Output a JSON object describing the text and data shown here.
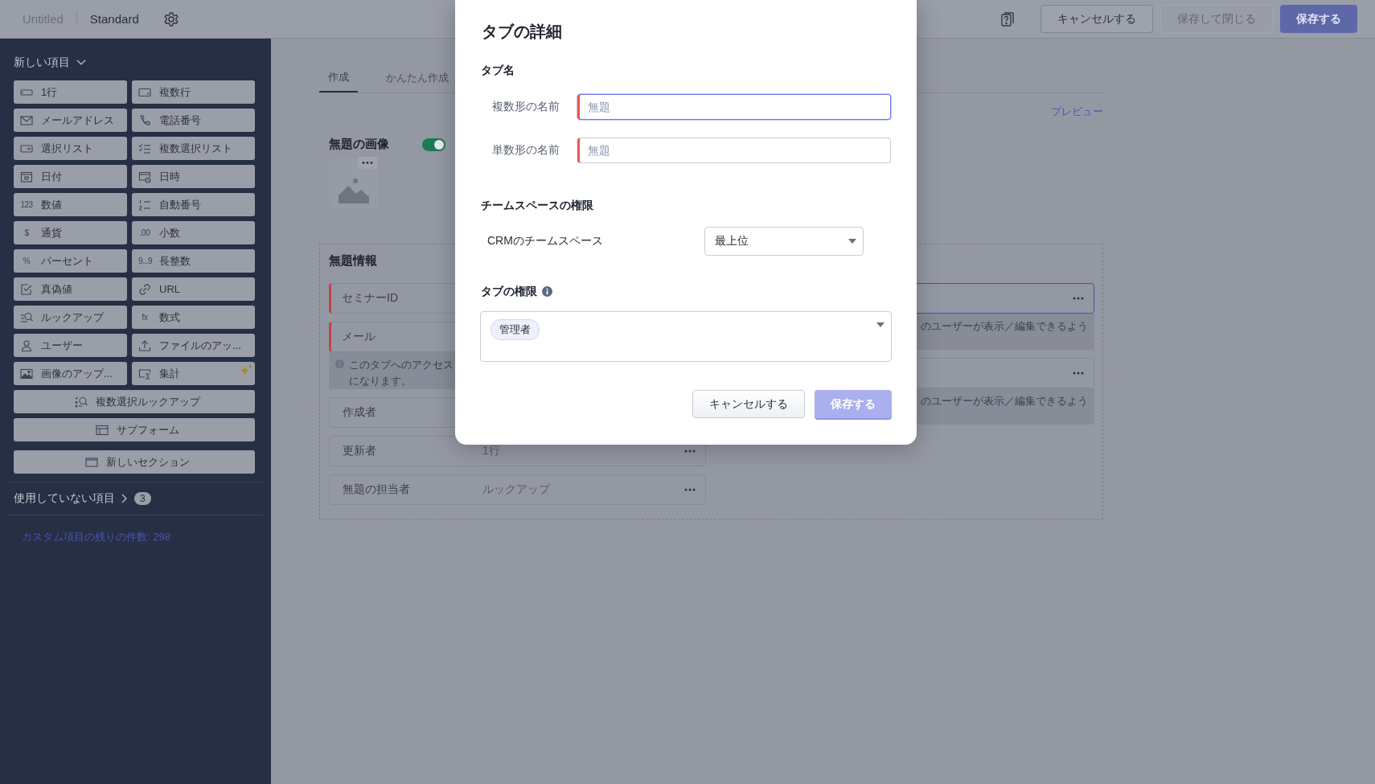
{
  "top_bar": {
    "title": "Untitled",
    "layout": "Standard",
    "buttons": [
      {
        "label": "キャンセルする",
        "kind": "secondary",
        "disabled": false
      },
      {
        "label": "保存して閉じる",
        "kind": "secondary",
        "disabled": true
      },
      {
        "label": "保存する",
        "kind": "primary",
        "disabled": false
      }
    ]
  },
  "sidebar": {
    "heading": "新しい項目",
    "field_types": [
      {
        "label": "1行"
      },
      {
        "label": "複数行"
      },
      {
        "label": "メールアドレス"
      },
      {
        "label": "電話番号"
      },
      {
        "label": "選択リスト"
      },
      {
        "label": "複数選択リスト"
      },
      {
        "label": "日付"
      },
      {
        "label": "日時"
      },
      {
        "label": "数値",
        "glyph": "123"
      },
      {
        "label": "自動番号"
      },
      {
        "label": "通貨",
        "glyph": "$"
      },
      {
        "label": "小数",
        "glyph": ".00"
      },
      {
        "label": "パーセント",
        "glyph": "%"
      },
      {
        "label": "長整数",
        "glyph": "9...9"
      },
      {
        "label": "真偽値"
      },
      {
        "label": "URL"
      },
      {
        "label": "ルックアップ"
      },
      {
        "label": "数式",
        "glyph": "fx"
      },
      {
        "label": "ユーザー"
      },
      {
        "label": "ファイルのアッ..."
      },
      {
        "label": "画像のアップ..."
      },
      {
        "label": "集計",
        "sparkle": true
      }
    ],
    "wide_items": [
      {
        "label": "複数選択ルックアップ"
      },
      {
        "label": "サブフォーム"
      },
      {
        "label": "新しいセクション"
      }
    ],
    "unused": {
      "label": "使用していない項目",
      "count": "3"
    },
    "remaining": "カスタム項目の残りの件数: 298"
  },
  "tabs": [
    {
      "label": "作成",
      "selected": true
    },
    {
      "label": "かんたん作成",
      "selected": false
    }
  ],
  "preview_link": "プレビュー",
  "image_field": {
    "title": "無題の画像",
    "on": true
  },
  "section": {
    "title": "無題情報",
    "left_rows": [
      {
        "kind": "field",
        "label": "セミナーID",
        "required": true
      },
      {
        "kind": "field",
        "label": "メール",
        "required": true
      },
      {
        "kind": "note",
        "lines": [
          "このタブへのアクセス",
          "になります。"
        ]
      },
      {
        "kind": "field",
        "label": "作成者",
        "required": false
      },
      {
        "kind": "field",
        "label": "更新者",
        "value": "1行",
        "required": false,
        "menu": true
      },
      {
        "kind": "field",
        "label": "無題の担当者",
        "value": "ルックアップ",
        "required": false,
        "menu": true
      }
    ],
    "right_rows": [
      {
        "kind": "field",
        "selected": true,
        "menu": true
      },
      {
        "kind": "note",
        "lines": [
          "のユーザーが表示／編集できるよう"
        ]
      },
      {
        "kind": "field",
        "selected": false,
        "menu": true
      },
      {
        "kind": "note",
        "lines": [
          "のユーザーが表示／編集できるよう"
        ]
      }
    ]
  },
  "dialog": {
    "title": "タブの詳細",
    "name_section": "タブ名",
    "name_fields": [
      {
        "label": "複数形の名前",
        "placeholder": "無題",
        "required": true,
        "focused": true
      },
      {
        "label": "単数形の名前",
        "placeholder": "無題",
        "required": true,
        "focused": false
      }
    ],
    "teamspace_section": "チームスペースの権限",
    "teamspace": {
      "label": "CRMのチームスペース",
      "value": "最上位"
    },
    "permission_section": "タブの権限",
    "permissions": [
      "管理者"
    ],
    "buttons": [
      {
        "label": "キャンセルする",
        "kind": "secondary"
      },
      {
        "label": "保存する",
        "kind": "primary"
      }
    ]
  }
}
